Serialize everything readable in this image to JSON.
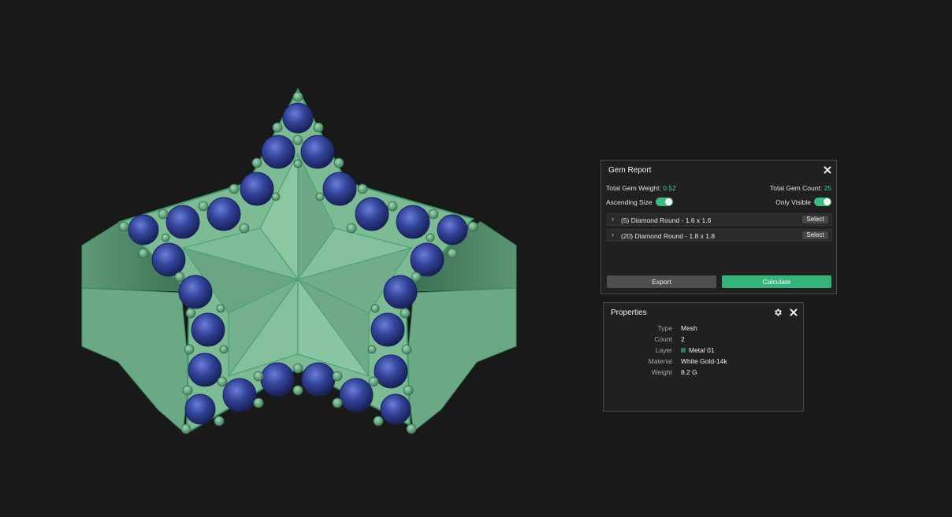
{
  "gem_report": {
    "title": "Gem Report",
    "total_weight_label": "Total Gem Weight:",
    "total_weight_value": "0.52",
    "total_count_label": "Total Gem Count:",
    "total_count_value": "25",
    "ascending_size_label": "Ascending Size",
    "ascending_size_on": true,
    "only_visible_label": "Only Visible",
    "only_visible_on": true,
    "rows": [
      {
        "label": "(5) Diamond Round - 1.6 x 1.6",
        "select_label": "Select"
      },
      {
        "label": "(20) Diamond Round - 1.8 x 1.8",
        "select_label": "Select"
      }
    ],
    "export_label": "Export",
    "calculate_label": "Calculate",
    "close_icon": "close-icon"
  },
  "properties": {
    "title": "Properties",
    "gear_icon": "gear-icon",
    "close_icon": "close-icon",
    "rows": [
      {
        "key": "Type",
        "value": "Mesh"
      },
      {
        "key": "Count",
        "value": "2"
      },
      {
        "key": "Layer",
        "value": "Metal 01"
      },
      {
        "key": "Material",
        "value": "White Gold-14k"
      },
      {
        "key": "Weight",
        "value": "8.2 G"
      }
    ]
  },
  "colors": {
    "background": "#191919",
    "accent_green": "#35b47a",
    "metal_green": "#6fae8a",
    "gem_blue": "#2c3a8c",
    "layer_swatch": "#2e7a55"
  }
}
